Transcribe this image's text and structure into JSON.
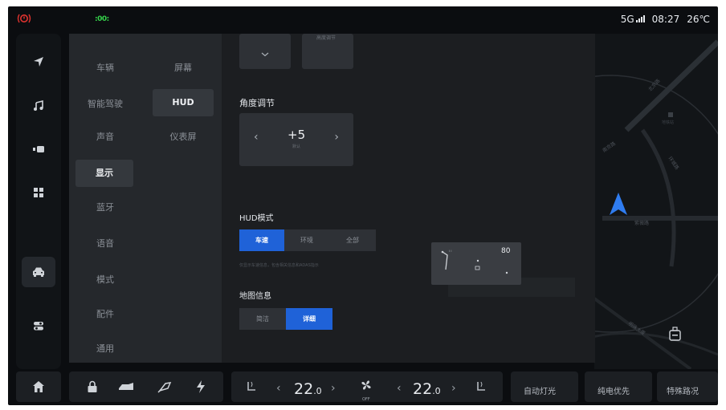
{
  "status_bar": {
    "network": "5G",
    "time": "08:27",
    "temperature": "26℃"
  },
  "rail": {
    "items": [
      {
        "icon": "navigation-icon"
      },
      {
        "icon": "music-icon"
      },
      {
        "icon": "camera-icon"
      },
      {
        "icon": "apps-grid-icon"
      },
      {
        "icon": "car-icon",
        "active": true
      },
      {
        "icon": "toggle-settings-icon"
      }
    ]
  },
  "categories": {
    "primary": [
      "车辆",
      "智能驾驶",
      "声音",
      "显示",
      "蓝牙",
      "语音",
      "模式",
      "配件",
      "通用"
    ],
    "primary_active": "显示",
    "secondary": [
      "屏幕",
      "HUD",
      "仪表屏"
    ],
    "secondary_active": "HUD"
  },
  "hud": {
    "height_partial_label": "高度调节",
    "angle_label": "角度调节",
    "angle_value": "+5",
    "angle_default": "默认",
    "mode_label": "HUD模式",
    "mode_options": [
      "车速",
      "环境",
      "全部"
    ],
    "mode_selected": "车速",
    "mode_hint": "仅显示车速信息，包含相关信息和ADAS指示",
    "map_label": "地图信息",
    "map_options": [
      "简洁",
      "详细"
    ],
    "map_selected": "详细",
    "preview_speed": "80"
  },
  "map": {
    "road_labels": [
      "北京路",
      "南京路",
      "环城路",
      "紫薇路"
    ],
    "poi_label": "地铁站",
    "poi_sublabel": "明珠大厦"
  },
  "dock": {
    "left_temp": "22",
    "left_temp_decimal": ".0",
    "right_temp": "22",
    "right_temp_decimal": ".0",
    "fan_status": "OFF",
    "buttons": [
      "自动灯光",
      "纯电优先",
      "特殊路况"
    ]
  },
  "colors": {
    "accent": "#1f62d8",
    "status_green": "#35d04a",
    "alert_red": "#e0332f",
    "nav_arrow": "#2f7cf0"
  }
}
